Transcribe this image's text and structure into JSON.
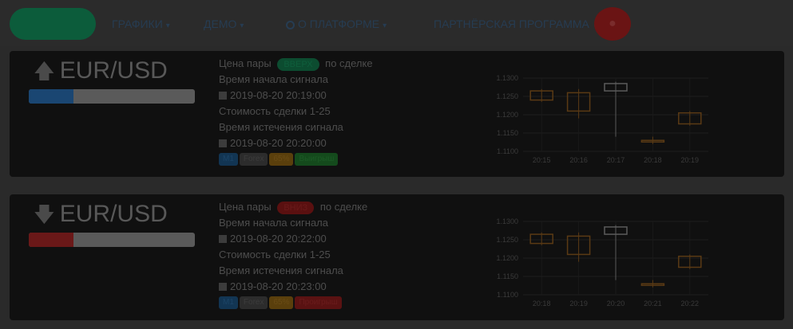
{
  "nav": {
    "items": [
      {
        "label": "ГРАФИКИ",
        "chevron": "▾"
      },
      {
        "label": "ДЕМО",
        "chevron": "▾"
      },
      {
        "label": "О ПЛАТФОРМЕ",
        "chevron": "▾"
      },
      {
        "label": "ПАРТНЁРСКАЯ ПРОГРАММА",
        "chevron": "▾"
      }
    ],
    "search_icon": "search-icon",
    "user_icon": "user-icon"
  },
  "signals": [
    {
      "pair": "EUR/USD",
      "direction": "up",
      "arrow": "🡅",
      "progress": 0.27,
      "progress_label": "27%",
      "direction_prefix": "Цена пары",
      "direction_label": "ВВЕРХ",
      "direction_suffix": "по сделке",
      "open_time_label": "Время начала сигнала",
      "open_time": "2019-08-20 20:19:00",
      "expiry_label": "Стоимость сделки 1-25",
      "close_time_label": "Время истечения сигнала",
      "close_time": "2019-08-20 20:20:00",
      "tags": [
        {
          "text": "M1",
          "color": "blue"
        },
        {
          "text": "Forex",
          "color": "gray"
        },
        {
          "text": "65%",
          "color": "orange"
        },
        {
          "text": "Выигрыш",
          "color": "green"
        }
      ]
    },
    {
      "pair": "EUR/USD",
      "direction": "down",
      "arrow": "🡇",
      "progress": 0.27,
      "progress_label": "27%",
      "direction_prefix": "Цена пары",
      "direction_label": "ВНИЗ",
      "direction_suffix": "по сделке",
      "open_time_label": "Время начала сигнала",
      "open_time": "2019-08-20 20:22:00",
      "expiry_label": "Стоимость сделки 1-25",
      "close_time_label": "Время истечения сигнала",
      "close_time": "2019-08-20 20:23:00",
      "tags": [
        {
          "text": "M1",
          "color": "blue"
        },
        {
          "text": "Forex",
          "color": "gray"
        },
        {
          "text": "65%",
          "color": "orange"
        },
        {
          "text": "Проигрыш",
          "color": "red"
        }
      ]
    }
  ],
  "chart_data": [
    {
      "type": "candlestick",
      "ylim": [
        1.11,
        1.13
      ],
      "yticks": [
        "1.1300",
        "1.1250",
        "1.1200",
        "1.1150",
        "1.1100"
      ],
      "categories": [
        "20:15",
        "20:16",
        "20:17",
        "20:18",
        "20:19"
      ],
      "candles": [
        {
          "open": 1.124,
          "close": 1.1265,
          "high": 1.127,
          "low": 1.1235,
          "color": "#5a3a14"
        },
        {
          "open": 1.126,
          "close": 1.121,
          "high": 1.127,
          "low": 1.119,
          "color": "#5a3a14"
        },
        {
          "open": 1.1265,
          "close": 1.1285,
          "high": 1.129,
          "low": 1.114,
          "color": "#5a5a5a"
        },
        {
          "open": 1.113,
          "close": 1.113,
          "high": 1.114,
          "low": 1.112,
          "color": "#5a3a14"
        },
        {
          "open": 1.1175,
          "close": 1.1205,
          "high": 1.121,
          "low": 1.117,
          "color": "#5a3a14"
        }
      ]
    },
    {
      "type": "candlestick",
      "ylim": [
        1.11,
        1.13
      ],
      "yticks": [
        "1.1300",
        "1.1250",
        "1.1200",
        "1.1150",
        "1.1100"
      ],
      "categories": [
        "20:18",
        "20:19",
        "20:20",
        "20:21",
        "20:22"
      ],
      "candles": [
        {
          "open": 1.124,
          "close": 1.1265,
          "high": 1.127,
          "low": 1.1235,
          "color": "#5a3a14"
        },
        {
          "open": 1.126,
          "close": 1.121,
          "high": 1.127,
          "low": 1.119,
          "color": "#5a3a14"
        },
        {
          "open": 1.1265,
          "close": 1.1285,
          "high": 1.129,
          "low": 1.114,
          "color": "#5a5a5a"
        },
        {
          "open": 1.113,
          "close": 1.113,
          "high": 1.114,
          "low": 1.112,
          "color": "#5a3a14"
        },
        {
          "open": 1.1175,
          "close": 1.1205,
          "high": 1.121,
          "low": 1.117,
          "color": "#5a3a14"
        }
      ]
    }
  ]
}
